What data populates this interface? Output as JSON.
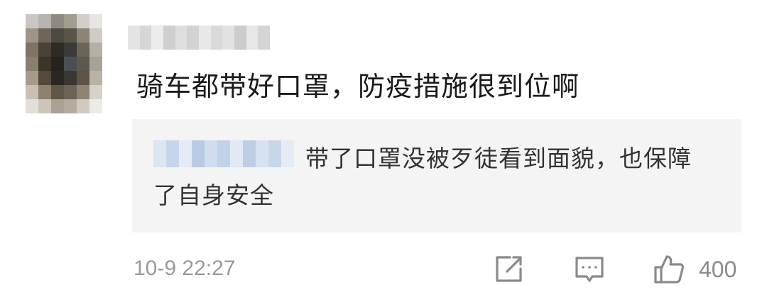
{
  "comment": {
    "text": "骑车都带好口罩，防疫措施很到位啊",
    "reply": {
      "text": "带了口罩没被歹徒看到面貌，也保障了自身安全"
    },
    "timestamp": "10-9 22:27",
    "like_count": "400",
    "icons": {
      "share": "share-icon",
      "reply": "comment-icon",
      "like": "thumbs-up-icon"
    }
  },
  "colors": {
    "text_primary": "#1a1a1a",
    "text_secondary": "#999999",
    "reply_background": "#f4f4f5",
    "icon": "#8a8a8a"
  }
}
